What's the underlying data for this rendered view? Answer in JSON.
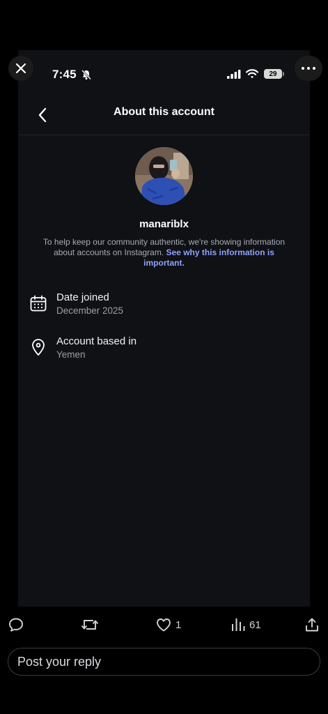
{
  "status_bar": {
    "time": "7:45",
    "battery": "29"
  },
  "nav": {
    "title": "About this account"
  },
  "profile": {
    "username": "manariblx",
    "info_text": "To help keep our community authentic, we're showing information about accounts on Instagram.",
    "info_link": "See why this information is important."
  },
  "details": [
    {
      "label": "Date joined",
      "value": "December 2025",
      "icon": "calendar-icon"
    },
    {
      "label": "Account based in",
      "value": "Yemen",
      "icon": "location-pin-icon"
    }
  ],
  "actions": {
    "reply_icon": "reply-icon",
    "repost_icon": "repost-icon",
    "like_icon": "heart-icon",
    "like_count": "1",
    "views_icon": "views-icon",
    "view_count": "61",
    "share_icon": "share-icon"
  },
  "reply_box": {
    "placeholder": "Post your reply"
  },
  "colors": {
    "link": "#8ea2ff",
    "background": "#0f1115"
  }
}
